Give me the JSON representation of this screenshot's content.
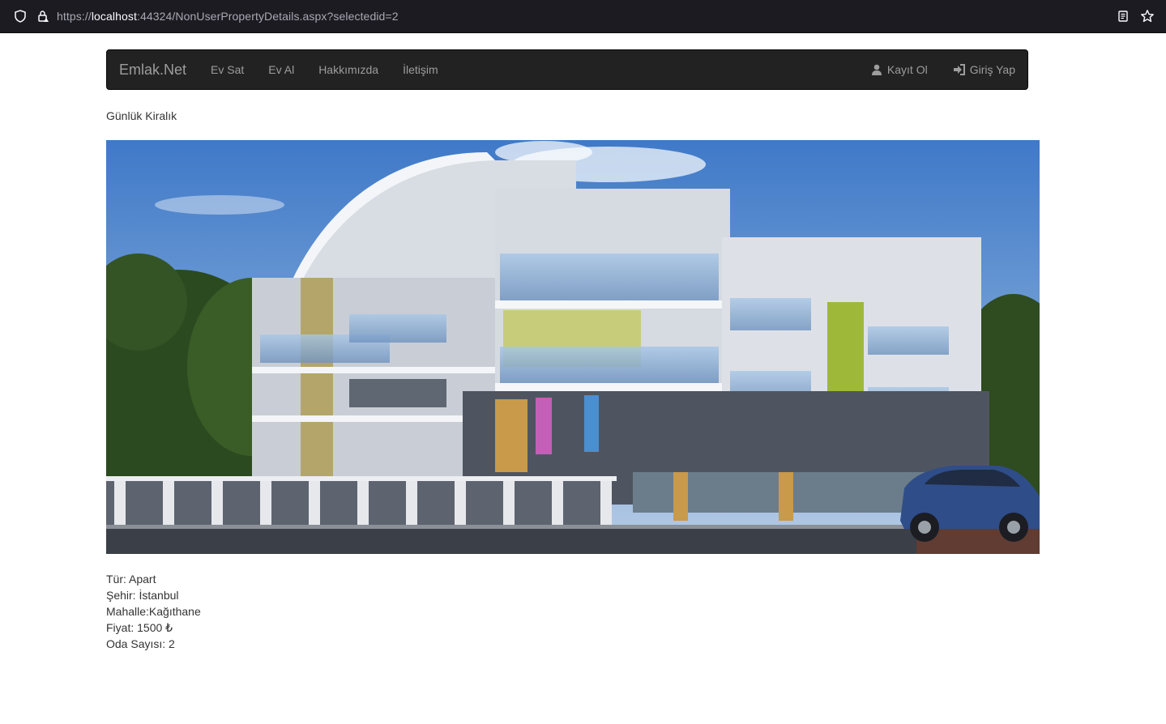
{
  "browser": {
    "url_scheme": "https://",
    "url_host": "localhost",
    "url_rest": ":44324/NonUserPropertyDetails.aspx?selectedid=2"
  },
  "navbar": {
    "brand": "Emlak.Net",
    "items": [
      {
        "label": "Ev Sat"
      },
      {
        "label": "Ev Al"
      },
      {
        "label": "Hakkımızda"
      },
      {
        "label": "İletişim"
      }
    ],
    "register_label": "Kayıt Ol",
    "login_label": "Giriş Yap"
  },
  "page": {
    "subtitle": "Günlük Kiralık",
    "details": {
      "type": "Tür: Apart",
      "city": "Şehir: İstanbul",
      "district": "Mahalle:Kağıthane",
      "price": "Fiyat: 1500 ₺",
      "rooms": "Oda Sayısı: 2"
    }
  },
  "colors": {
    "navbar_bg": "#222222",
    "nav_text": "#9d9d9d",
    "browser_bg": "#1c1b22"
  },
  "icons": {
    "shield": "shield-icon",
    "lock": "lock-icon",
    "reader": "reader-view-icon",
    "star": "bookmark-star-icon",
    "user": "user-icon",
    "login": "login-icon"
  }
}
